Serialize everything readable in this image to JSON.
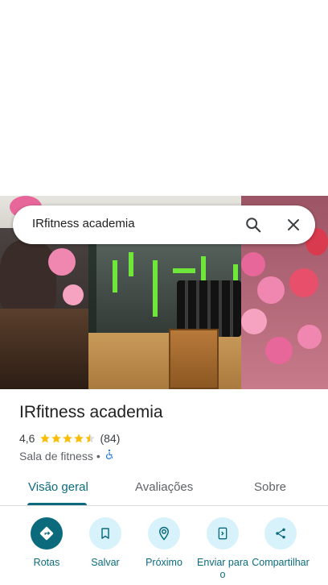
{
  "search": {
    "query": "IRfitness academia"
  },
  "place": {
    "name": "IRfitness academia",
    "rating": "4,6",
    "stars": 4.5,
    "review_count": "(84)",
    "category": "Sala de fitness",
    "separator": "•"
  },
  "tabs": [
    {
      "label": "Visão geral",
      "active": true
    },
    {
      "label": "Avaliações",
      "active": false
    },
    {
      "label": "Sobre",
      "active": false
    }
  ],
  "actions": [
    {
      "label": "Rotas",
      "icon": "directions-icon"
    },
    {
      "label": "Salvar",
      "icon": "bookmark-icon"
    },
    {
      "label": "Próximo",
      "icon": "nearby-icon"
    },
    {
      "label": "Enviar para o",
      "icon": "send-to-phone-icon"
    },
    {
      "label": "Compartilhar",
      "icon": "share-icon"
    }
  ],
  "colors": {
    "accent": "#0b6b7c",
    "action_bg": "#d7f2fb",
    "star": "#fbbc04"
  }
}
